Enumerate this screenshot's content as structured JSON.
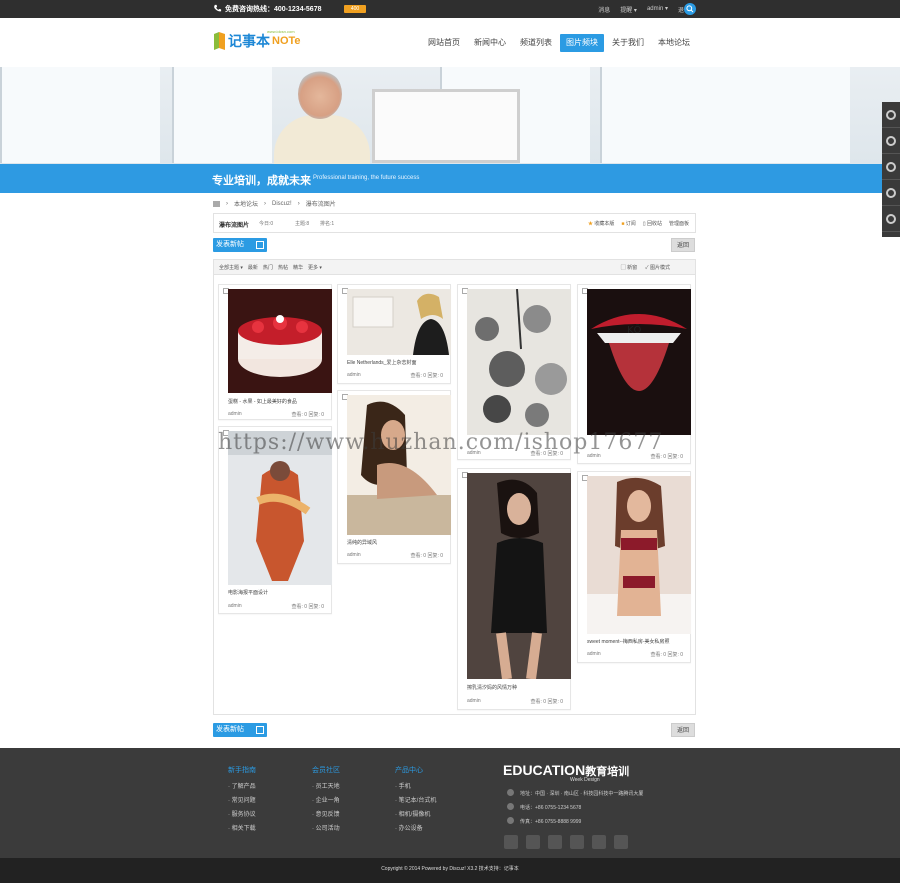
{
  "topbar": {
    "hotline": "免费咨询热线：400-1234-5678",
    "badge": "400",
    "links": [
      "消息",
      "提醒 ▾",
      "admin ▾",
      "退出"
    ]
  },
  "logo": {
    "cn": "记事本",
    "en": "NOTe",
    "sub": "www.idcsn.com"
  },
  "nav": [
    "网站首页",
    "新闻中心",
    "频道列表",
    "图片频块",
    "关于我们",
    "本地论坛"
  ],
  "nav_active": 3,
  "banner": {
    "title": "专业培训，成就未来",
    "subtitle": "Professional training, the future success"
  },
  "breadcrumb": [
    "本地论坛",
    "Discuz!",
    "瀑布流图片"
  ],
  "forum": {
    "name": "瀑布流图片",
    "today": "0",
    "topics": "8",
    "rank": "1",
    "today_label": "今日:",
    "topics_label": "主题:",
    "rank_label": "排名:",
    "actions": [
      "收藏本版",
      "订阅",
      "回收站",
      "管理面板"
    ]
  },
  "buttons": {
    "post": "发表新帖",
    "back": "返回"
  },
  "filter": {
    "left": [
      "全部主题 ▾",
      "最新",
      "热门",
      "热帖",
      "精华",
      "更多 ▾"
    ],
    "right": [
      "新窗",
      "图片模式"
    ]
  },
  "posts": [
    {
      "caption": "蛋糕 - 水果 - 如上最美好的食品",
      "author": "admin",
      "views": "查看: 0",
      "replies": "回复: 0"
    },
    {
      "caption": "Elle Netherlands_爱上杂志封面",
      "author": "admin",
      "views": "查看: 0",
      "replies": "回复: 0"
    },
    {
      "caption": "",
      "author": "admin",
      "views": "查看: 0",
      "replies": "回复: 0"
    },
    {
      "caption": "",
      "author": "admin",
      "views": "查看: 0",
      "replies": "回复: 0"
    },
    {
      "caption": "电影海报平面设计",
      "author": "admin",
      "views": "查看: 0",
      "replies": "回复: 0"
    },
    {
      "caption": "清纯的异域风",
      "author": "admin",
      "views": "查看: 0",
      "replies": "回复: 0"
    },
    {
      "caption": "擦乳清汐妈的风情万种",
      "author": "admin",
      "views": "查看: 0",
      "replies": "回复: 0"
    },
    {
      "caption": "sweet moment--梅西私房-美女私房照",
      "author": "admin",
      "views": "查看: 0",
      "replies": "回复: 0"
    }
  ],
  "watermark": "https://www.huzhan.com/ishop17677",
  "footer": {
    "cols": [
      {
        "title": "新手指南",
        "items": [
          "了解产品",
          "常见问题",
          "服务协议",
          "相关下载"
        ]
      },
      {
        "title": "会员社区",
        "items": [
          "员工天地",
          "企业一角",
          "意见反馈",
          "公司活动"
        ]
      },
      {
        "title": "产品中心",
        "items": [
          "手机",
          "笔记本/台式机",
          "相机/摄像机",
          "办公设备"
        ]
      }
    ],
    "brand": "EDUCATION",
    "brand_cn": "教育培训",
    "brand_sub": "Week Design",
    "contact": [
      "地址：中国 · 深圳 · 南山区 · 科技园科技中一路腾讯大厦",
      "电话：+86 0755-1234 5678",
      "传真：+86 0755-8888 9999"
    ]
  },
  "copyright": "Copyright © 2014 Powered by Discuz! X3.2 技术支持：记事本"
}
